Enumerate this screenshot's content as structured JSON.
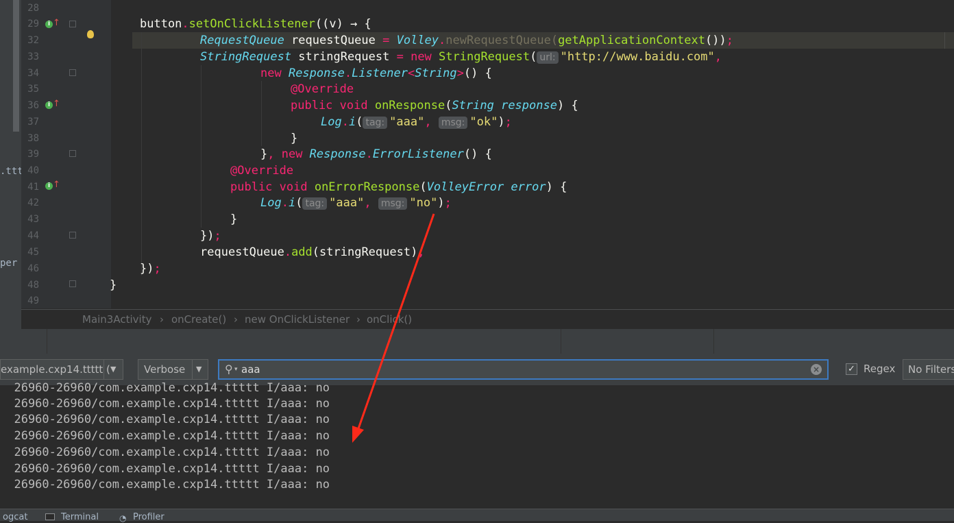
{
  "left_strip": {
    "text1": ".tttt",
    "text2": "per"
  },
  "line_numbers": [
    "28",
    "29",
    "32",
    "33",
    "34",
    "35",
    "36",
    "37",
    "38",
    "39",
    "40",
    "41",
    "42",
    "43",
    "44",
    "45",
    "46",
    "48",
    "49"
  ],
  "code": {
    "l29_a": "button",
    "l29_b": ".",
    "l29_c": "setOnClickListener",
    "l29_d": "((v) → {",
    "l32_a": "RequestQueue",
    "l32_b": " requestQueue ",
    "l32_c": "=",
    "l32_d": " Volley",
    "l32_e": ".",
    "l32_f": "newRequestQueue",
    "l32_g": "(",
    "l32_h": "getApplicationContext",
    "l32_i": "())",
    "l32_j": ";",
    "l33_a": "StringRequest",
    "l33_b": " stringRequest ",
    "l33_c": "=",
    "l33_d": " new ",
    "l33_e": "StringRequest",
    "l33_f": "(",
    "l33_hint": "url:",
    "l33_g": "\"http://www.baidu.com\"",
    "l33_h": ",",
    "l34_a": "new ",
    "l34_b": "Response",
    "l34_c": ".",
    "l34_d": "Listener",
    "l34_e": "<",
    "l34_f": "String",
    "l34_g": ">",
    "l34_h": "() {",
    "l35": "@Override",
    "l36_a": "public void ",
    "l36_b": "onResponse",
    "l36_c": "(",
    "l36_d": "String response",
    "l36_e": ") {",
    "l37_a": "Log",
    "l37_b": ".",
    "l37_c": "i",
    "l37_d": "(",
    "l37_hint1": "tag:",
    "l37_e": "\"aaa\"",
    "l37_f": ", ",
    "l37_hint2": "msg:",
    "l37_g": "\"ok\"",
    "l37_h": ")",
    "l37_i": ";",
    "l38": "}",
    "l39_a": "}",
    "l39_b": ", new ",
    "l39_c": "Response",
    "l39_d": ".",
    "l39_e": "ErrorListener",
    "l39_f": "() {",
    "l40": "@Override",
    "l41_a": "public void ",
    "l41_b": "onErrorResponse",
    "l41_c": "(",
    "l41_d": "VolleyError error",
    "l41_e": ") {",
    "l42_a": "Log",
    "l42_b": ".",
    "l42_c": "i",
    "l42_d": "(",
    "l42_hint1": "tag:",
    "l42_e": "\"aaa\"",
    "l42_f": ", ",
    "l42_hint2": "msg:",
    "l42_g": "\"no\"",
    "l42_h": ")",
    "l42_i": ";",
    "l43": "}",
    "l44_a": "})",
    "l44_b": ";",
    "l45_a": "requestQueue",
    "l45_b": ".",
    "l45_c": "add",
    "l45_d": "(stringRequest)",
    "l45_e": ";",
    "l46_a": "})",
    "l46_b": ";",
    "l48": "}"
  },
  "breadcrumb": [
    "Main3Activity",
    "onCreate()",
    "new OnClickListener",
    "onClick()"
  ],
  "breadcrumb_sep": "›",
  "toolbar": {
    "process": "example.cxp14.ttttt (",
    "level": "Verbose",
    "search_value": "aaa",
    "regex_label": "Regex",
    "regex_checked": true,
    "filter": "No Filters"
  },
  "log_lines": [
    "  26960-26960/com.example.cxp14.ttttt I/aaa: no",
    "  26960-26960/com.example.cxp14.ttttt I/aaa: no",
    "  26960-26960/com.example.cxp14.ttttt I/aaa: no",
    "  26960-26960/com.example.cxp14.ttttt I/aaa: no",
    "  26960-26960/com.example.cxp14.ttttt I/aaa: no",
    "  26960-26960/com.example.cxp14.ttttt I/aaa: no",
    "  26960-26960/com.example.cxp14.ttttt I/aaa: no"
  ],
  "bottom_tabs": [
    "ogcat",
    "Terminal",
    "Profiler"
  ],
  "colors": {
    "accent_arrow": "#ff2a1a",
    "keyword": "#f92672",
    "method": "#a6e22e",
    "type": "#66d9ef",
    "string": "#e6db74"
  }
}
